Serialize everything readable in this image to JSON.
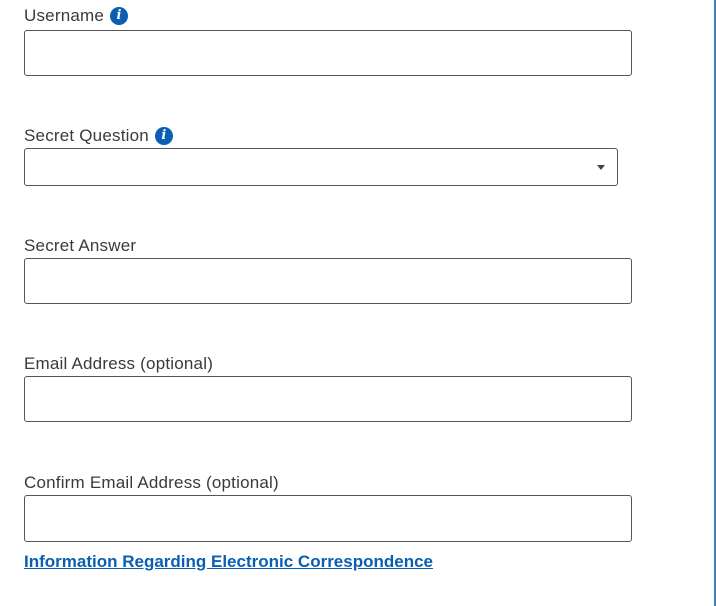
{
  "form": {
    "username": {
      "label": "Username",
      "value": "",
      "info_icon": "info-circle-icon"
    },
    "secret_question": {
      "label": "Secret Question",
      "selected": "",
      "info_icon": "info-circle-icon"
    },
    "secret_answer": {
      "label": "Secret Answer",
      "value": ""
    },
    "email": {
      "label": "Email Address (optional)",
      "value": ""
    },
    "confirm_email": {
      "label": "Confirm Email Address (optional)",
      "value": ""
    },
    "correspondence_link": "Information Regarding Electronic Correspondence"
  },
  "colors": {
    "accent": "#0a5fb4",
    "text": "#3a3a3a",
    "border": "#555555"
  }
}
